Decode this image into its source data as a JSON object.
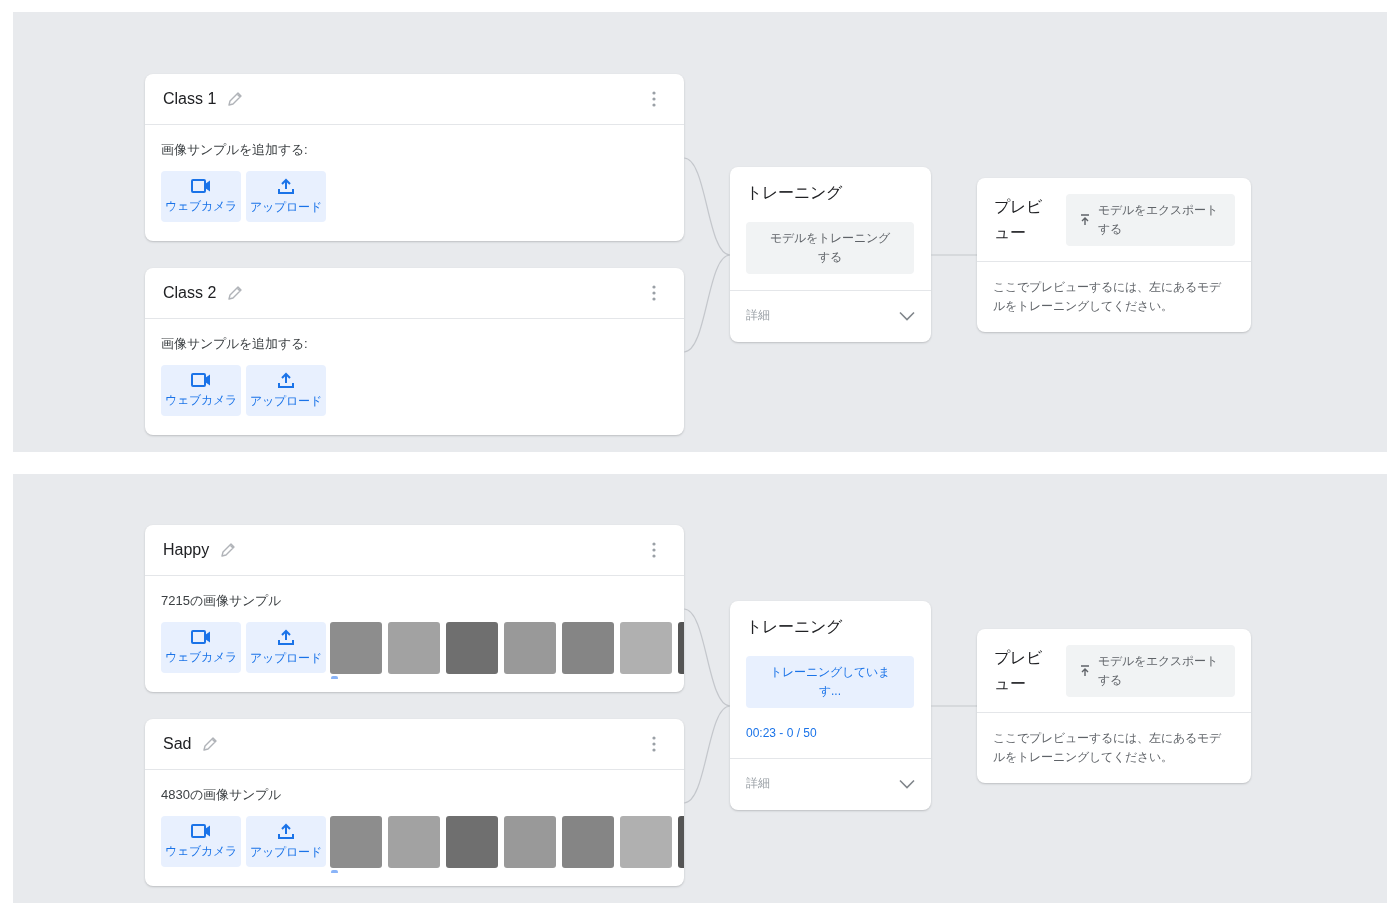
{
  "panels": [
    {
      "classes": [
        {
          "name": "Class 1",
          "caption": "画像サンプルを追加する:",
          "buttons": [
            {
              "kind": "webcam",
              "label": "ウェブカメラ"
            },
            {
              "kind": "upload",
              "label": "アップロード"
            }
          ]
        },
        {
          "name": "Class 2",
          "caption": "画像サンプルを追加する:",
          "buttons": [
            {
              "kind": "webcam",
              "label": "ウェブカメラ"
            },
            {
              "kind": "upload",
              "label": "アップロード"
            }
          ]
        }
      ],
      "training": {
        "title": "トレーニング",
        "button": "モデルをトレーニングする",
        "training": false,
        "details": "詳細",
        "expanded": false
      },
      "preview": {
        "title": "プレビュー",
        "export_button": "モデルをエクスポートする",
        "message": "ここでプレビューするには、左にあるモデルをトレーニングしてください。"
      }
    },
    {
      "classes": [
        {
          "name": "Happy",
          "caption": "7215の画像サンプル",
          "buttons": [
            {
              "kind": "webcam",
              "label": "ウェブカメラ"
            },
            {
              "kind": "upload",
              "label": "アップロード"
            }
          ],
          "thumbnails": [
            {
              "kind": "photo"
            },
            {
              "kind": "photo"
            },
            {
              "kind": "photo"
            },
            {
              "kind": "photo"
            },
            {
              "kind": "photo"
            },
            {
              "kind": "photo"
            },
            {
              "kind": "photo"
            }
          ]
        },
        {
          "name": "Sad",
          "caption": "4830の画像サンプル",
          "buttons": [
            {
              "kind": "webcam",
              "label": "ウェブカメラ"
            },
            {
              "kind": "upload",
              "label": "アップロード"
            }
          ],
          "thumbnails": [
            {
              "kind": "photo"
            },
            {
              "kind": "photo"
            },
            {
              "kind": "photo"
            },
            {
              "kind": "photo"
            },
            {
              "kind": "photo"
            },
            {
              "kind": "photo"
            },
            {
              "kind": "photo"
            }
          ]
        }
      ],
      "training": {
        "title": "トレーニング",
        "button": "トレーニングしています...",
        "training": true,
        "progress": "00:23 - 0 / 50",
        "details": "詳細",
        "expanded": false
      },
      "preview": {
        "title": "プレビュー",
        "export_button": "モデルをエクスポートする",
        "message": "ここでプレビューするには、左にあるモデルをトレーニングしてください。"
      }
    }
  ]
}
